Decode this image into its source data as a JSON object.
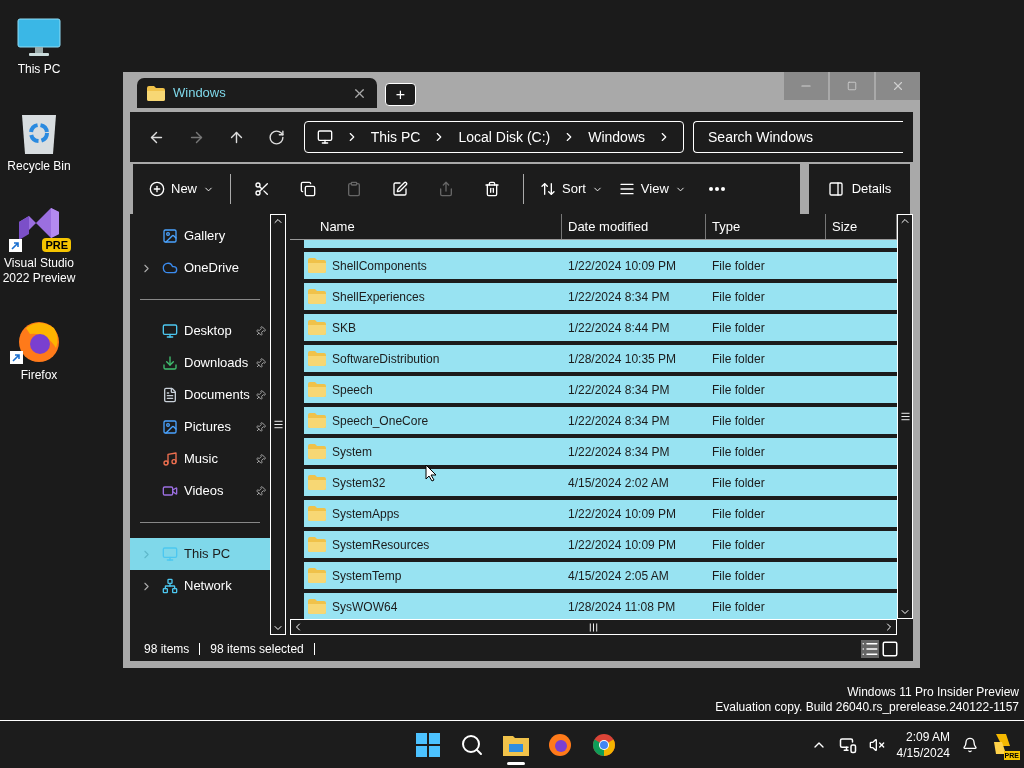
{
  "desktop_icons": [
    {
      "label": "This PC",
      "shortcut": false
    },
    {
      "label": "Recycle Bin",
      "shortcut": false
    },
    {
      "label": "Visual Studio 2022 Preview",
      "shortcut": true,
      "badge": "PRE"
    },
    {
      "label": "Firefox",
      "shortcut": true
    }
  ],
  "window": {
    "tabs": [
      {
        "label": "Windows",
        "selected": true
      }
    ],
    "new_tab": "+"
  },
  "address": {
    "breadcrumb": [
      "This PC",
      "Local Disk (C:)",
      "Windows"
    ],
    "search": {
      "placeholder": "Search Windows"
    }
  },
  "toolbar": {
    "items": [
      {
        "kind": "menu",
        "label": "New",
        "disabled": false
      },
      {
        "kind": "divider"
      },
      {
        "kind": "icon",
        "disabled": false
      },
      {
        "kind": "icon",
        "disabled": false
      },
      {
        "kind": "icon",
        "disabled": true
      },
      {
        "kind": "icon",
        "disabled": false
      },
      {
        "kind": "icon",
        "disabled": true
      },
      {
        "kind": "icon",
        "disabled": false
      },
      {
        "kind": "divider"
      },
      {
        "kind": "menu",
        "label": "Sort",
        "disabled": false
      },
      {
        "kind": "menu",
        "label": "View",
        "disabled": false
      },
      {
        "kind": "icon",
        "disabled": false
      }
    ],
    "details": "Details"
  },
  "sidebar": {
    "groups": [
      [
        {
          "label": "Gallery",
          "expandable": false,
          "pinned": false,
          "selected": false
        },
        {
          "label": "OneDrive",
          "expandable": true,
          "pinned": false,
          "selected": false
        }
      ],
      [
        {
          "label": "Desktop",
          "expandable": false,
          "pinned": true,
          "selected": false
        },
        {
          "label": "Downloads",
          "expandable": false,
          "pinned": true,
          "selected": false
        },
        {
          "label": "Documents",
          "expandable": false,
          "pinned": true,
          "selected": false
        },
        {
          "label": "Pictures",
          "expandable": false,
          "pinned": true,
          "selected": false
        },
        {
          "label": "Music",
          "expandable": false,
          "pinned": true,
          "selected": false
        },
        {
          "label": "Videos",
          "expandable": false,
          "pinned": true,
          "selected": false
        }
      ],
      [
        {
          "label": "This PC",
          "expandable": true,
          "pinned": false,
          "selected": true
        },
        {
          "label": "Network",
          "expandable": true,
          "pinned": false,
          "selected": false
        }
      ]
    ]
  },
  "table": {
    "columns": [
      "Name",
      "Date modified",
      "Type",
      "Size"
    ],
    "rows": [
      {
        "name": "ShellComponents",
        "date": "1/22/2024 10:09 PM",
        "type": "File folder",
        "selected": true
      },
      {
        "name": "ShellExperiences",
        "date": "1/22/2024 8:34 PM",
        "type": "File folder",
        "selected": true
      },
      {
        "name": "SKB",
        "date": "1/22/2024 8:44 PM",
        "type": "File folder",
        "selected": true
      },
      {
        "name": "SoftwareDistribution",
        "date": "1/28/2024 10:35 PM",
        "type": "File folder",
        "selected": true
      },
      {
        "name": "Speech",
        "date": "1/22/2024 8:34 PM",
        "type": "File folder",
        "selected": true
      },
      {
        "name": "Speech_OneCore",
        "date": "1/22/2024 8:34 PM",
        "type": "File folder",
        "selected": true
      },
      {
        "name": "System",
        "date": "1/22/2024 8:34 PM",
        "type": "File folder",
        "selected": true
      },
      {
        "name": "System32",
        "date": "4/15/2024 2:02 AM",
        "type": "File folder",
        "selected": true
      },
      {
        "name": "SystemApps",
        "date": "1/22/2024 10:09 PM",
        "type": "File folder",
        "selected": true
      },
      {
        "name": "SystemResources",
        "date": "1/22/2024 10:09 PM",
        "type": "File folder",
        "selected": true
      },
      {
        "name": "SystemTemp",
        "date": "4/15/2024 2:05 AM",
        "type": "File folder",
        "selected": true
      },
      {
        "name": "SysWOW64",
        "date": "1/28/2024 11:08 PM",
        "type": "File folder",
        "selected": true
      }
    ]
  },
  "status_bar": {
    "count": "98 items",
    "selection": "98 items selected"
  },
  "watermark_os": [
    "Windows 11 Pro Insider Preview",
    "Evaluation copy. Build 26040.rs_prerelease.240122-1157"
  ],
  "taskbar": {
    "apps": [
      {
        "active": false
      },
      {
        "active": false
      },
      {
        "active": true
      },
      {
        "active": false
      },
      {
        "active": false
      }
    ],
    "time": "2:09 AM",
    "date": "4/15/2024",
    "copilot_badge": "PRE"
  }
}
